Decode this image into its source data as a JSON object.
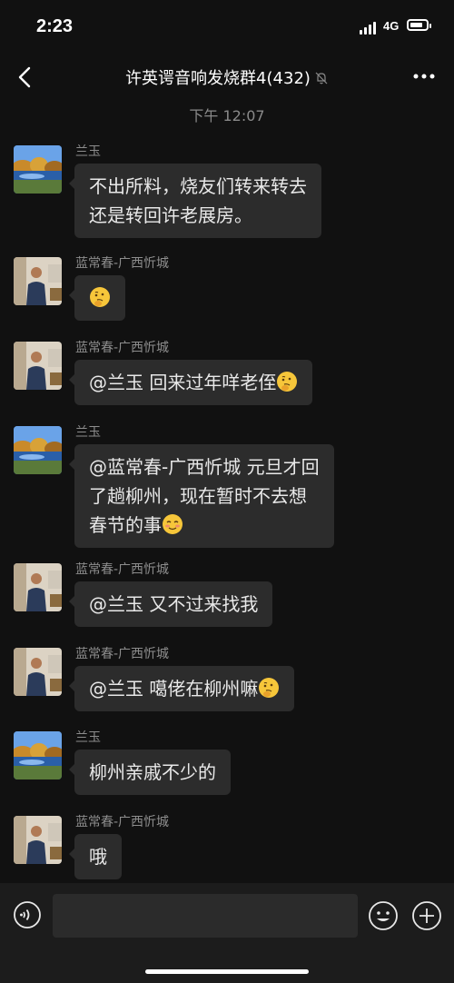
{
  "status": {
    "time": "2:23",
    "network": "4G",
    "battery_level": 0.8
  },
  "header": {
    "title": "许英谔音响发烧群4(432)",
    "back_icon": "chevron-left-icon",
    "mute_icon": "bell-mute-icon",
    "more_icon": "more-dots-icon"
  },
  "timestamp": "下午 12:07",
  "colors": {
    "background": "#111111",
    "bubble": "#2c2c2c",
    "text": "#e9e9e9",
    "sender": "#8d8d8d"
  },
  "messages": [
    {
      "sender": "兰玉",
      "lines": [
        "不出所料，烧友们转来转去",
        "还是转回许老展房。"
      ],
      "avatar": "landscape"
    },
    {
      "sender": "蓝常春-广西忻城",
      "lines": [
        ""
      ],
      "emoji": "thinking-face",
      "avatar": "person"
    },
    {
      "sender": "蓝常春-广西忻城",
      "lines": [
        "@兰玉 回来过年咩老侄"
      ],
      "emoji": "thinking-face",
      "avatar": "person"
    },
    {
      "sender": "兰玉",
      "lines": [
        "@蓝常春-广西忻城 元旦才回",
        "了趟柳州，现在暂时不去想",
        "春节的事"
      ],
      "emoji": "blush-face",
      "avatar": "landscape"
    },
    {
      "sender": "蓝常春-广西忻城",
      "lines": [
        "@兰玉 又不过来找我"
      ],
      "avatar": "person"
    },
    {
      "sender": "蓝常春-广西忻城",
      "lines": [
        "@兰玉 噶佬在柳州嘛"
      ],
      "emoji": "thinking-face",
      "avatar": "person"
    },
    {
      "sender": "兰玉",
      "lines": [
        "柳州亲戚不少的"
      ],
      "avatar": "landscape"
    },
    {
      "sender": "蓝常春-广西忻城",
      "lines": [
        "哦"
      ],
      "avatar": "person"
    }
  ],
  "input": {
    "voice_icon": "voice-icon",
    "emoji_icon": "emoji-icon",
    "plus_icon": "plus-icon"
  }
}
